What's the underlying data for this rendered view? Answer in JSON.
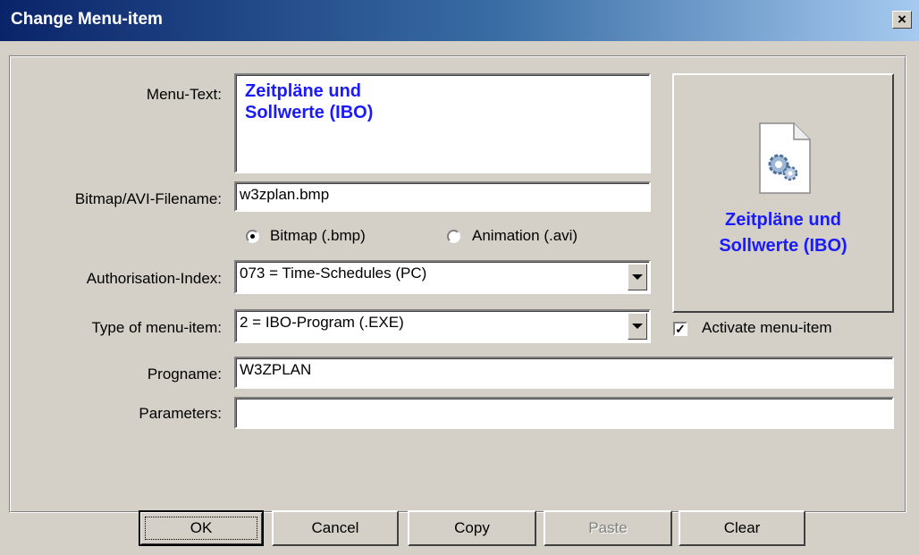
{
  "window": {
    "title": "Change Menu-item",
    "close_label": "×"
  },
  "form": {
    "menu_text_label": "Menu-Text:",
    "menu_text_value": "Zeitpläne und\nSollwerte (IBO)",
    "bitmap_label": "Bitmap/AVI-Filename:",
    "bitmap_value": "w3zplan.bmp",
    "radio_bitmap_label": "Bitmap (.bmp)",
    "radio_animation_label": "Animation (.avi)",
    "radio_selected": "bitmap",
    "auth_label": "Authorisation-Index:",
    "auth_value": "073 = Time-Schedules (PC)",
    "type_label": "Type of menu-item:",
    "type_value": "2 = IBO-Program (.EXE)",
    "activate_label": "Activate menu-item",
    "activate_checked": true,
    "progname_label": "Progname:",
    "progname_value": "W3ZPLAN",
    "parameters_label": "Parameters:",
    "parameters_value": ""
  },
  "preview": {
    "icon": "settings-document-icon",
    "text": "Zeitpläne und\nSollwerte (IBO)"
  },
  "buttons": {
    "ok": "OK",
    "cancel": "Cancel",
    "copy": "Copy",
    "paste": "Paste",
    "clear": "Clear"
  },
  "colors": {
    "title_start": "#0a246a",
    "title_end": "#a6caf0",
    "accent_text": "#1a1aff",
    "face": "#d4d0c8"
  }
}
